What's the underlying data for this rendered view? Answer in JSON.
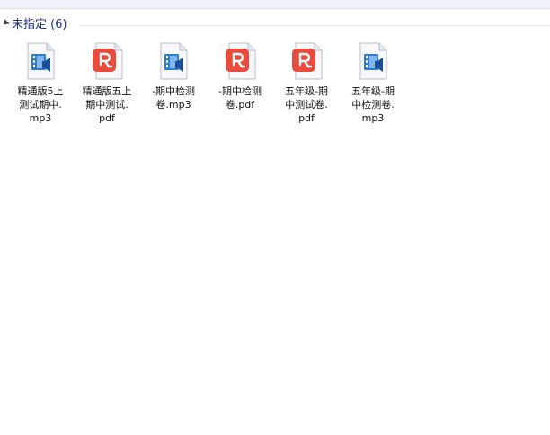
{
  "group": {
    "title": "未指定 (6)"
  },
  "files": [
    {
      "icon": "audio-video-file-icon",
      "name_lines": [
        "精通版5上",
        "测试期中.",
        "mp3"
      ]
    },
    {
      "icon": "pdf-file-icon",
      "name_lines": [
        "精通版五上",
        "期中测试.",
        "pdf"
      ]
    },
    {
      "icon": "audio-video-file-icon",
      "name_lines": [
        "-期中检测",
        "卷.mp3"
      ]
    },
    {
      "icon": "pdf-file-icon",
      "name_lines": [
        "-期中检测",
        "卷.pdf"
      ]
    },
    {
      "icon": "pdf-file-icon",
      "name_lines": [
        "五年级-期",
        "中测试卷.",
        "pdf"
      ]
    },
    {
      "icon": "audio-video-file-icon",
      "name_lines": [
        "五年级-期",
        "中检测卷.",
        "mp3"
      ]
    }
  ],
  "colors": {
    "group_title": "#1e3287",
    "pdf_red": "#e94b3c",
    "media_blue": "#2d7dd2"
  }
}
